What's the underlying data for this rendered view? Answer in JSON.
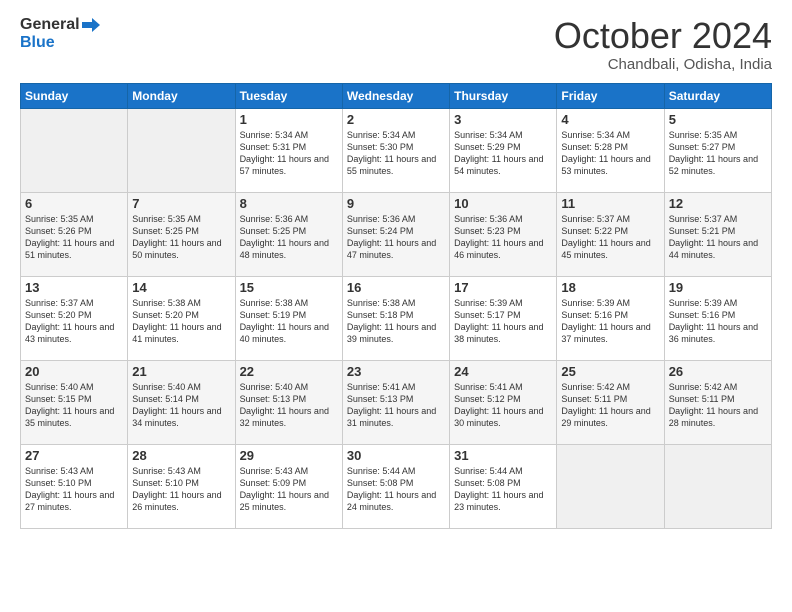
{
  "header": {
    "logo_line1": "General",
    "logo_line2": "Blue",
    "month": "October 2024",
    "location": "Chandbali, Odisha, India"
  },
  "weekdays": [
    "Sunday",
    "Monday",
    "Tuesday",
    "Wednesday",
    "Thursday",
    "Friday",
    "Saturday"
  ],
  "weeks": [
    [
      {
        "day": "",
        "info": ""
      },
      {
        "day": "",
        "info": ""
      },
      {
        "day": "1",
        "info": "Sunrise: 5:34 AM\nSunset: 5:31 PM\nDaylight: 11 hours and 57 minutes."
      },
      {
        "day": "2",
        "info": "Sunrise: 5:34 AM\nSunset: 5:30 PM\nDaylight: 11 hours and 55 minutes."
      },
      {
        "day": "3",
        "info": "Sunrise: 5:34 AM\nSunset: 5:29 PM\nDaylight: 11 hours and 54 minutes."
      },
      {
        "day": "4",
        "info": "Sunrise: 5:34 AM\nSunset: 5:28 PM\nDaylight: 11 hours and 53 minutes."
      },
      {
        "day": "5",
        "info": "Sunrise: 5:35 AM\nSunset: 5:27 PM\nDaylight: 11 hours and 52 minutes."
      }
    ],
    [
      {
        "day": "6",
        "info": "Sunrise: 5:35 AM\nSunset: 5:26 PM\nDaylight: 11 hours and 51 minutes."
      },
      {
        "day": "7",
        "info": "Sunrise: 5:35 AM\nSunset: 5:25 PM\nDaylight: 11 hours and 50 minutes."
      },
      {
        "day": "8",
        "info": "Sunrise: 5:36 AM\nSunset: 5:25 PM\nDaylight: 11 hours and 48 minutes."
      },
      {
        "day": "9",
        "info": "Sunrise: 5:36 AM\nSunset: 5:24 PM\nDaylight: 11 hours and 47 minutes."
      },
      {
        "day": "10",
        "info": "Sunrise: 5:36 AM\nSunset: 5:23 PM\nDaylight: 11 hours and 46 minutes."
      },
      {
        "day": "11",
        "info": "Sunrise: 5:37 AM\nSunset: 5:22 PM\nDaylight: 11 hours and 45 minutes."
      },
      {
        "day": "12",
        "info": "Sunrise: 5:37 AM\nSunset: 5:21 PM\nDaylight: 11 hours and 44 minutes."
      }
    ],
    [
      {
        "day": "13",
        "info": "Sunrise: 5:37 AM\nSunset: 5:20 PM\nDaylight: 11 hours and 43 minutes."
      },
      {
        "day": "14",
        "info": "Sunrise: 5:38 AM\nSunset: 5:20 PM\nDaylight: 11 hours and 41 minutes."
      },
      {
        "day": "15",
        "info": "Sunrise: 5:38 AM\nSunset: 5:19 PM\nDaylight: 11 hours and 40 minutes."
      },
      {
        "day": "16",
        "info": "Sunrise: 5:38 AM\nSunset: 5:18 PM\nDaylight: 11 hours and 39 minutes."
      },
      {
        "day": "17",
        "info": "Sunrise: 5:39 AM\nSunset: 5:17 PM\nDaylight: 11 hours and 38 minutes."
      },
      {
        "day": "18",
        "info": "Sunrise: 5:39 AM\nSunset: 5:16 PM\nDaylight: 11 hours and 37 minutes."
      },
      {
        "day": "19",
        "info": "Sunrise: 5:39 AM\nSunset: 5:16 PM\nDaylight: 11 hours and 36 minutes."
      }
    ],
    [
      {
        "day": "20",
        "info": "Sunrise: 5:40 AM\nSunset: 5:15 PM\nDaylight: 11 hours and 35 minutes."
      },
      {
        "day": "21",
        "info": "Sunrise: 5:40 AM\nSunset: 5:14 PM\nDaylight: 11 hours and 34 minutes."
      },
      {
        "day": "22",
        "info": "Sunrise: 5:40 AM\nSunset: 5:13 PM\nDaylight: 11 hours and 32 minutes."
      },
      {
        "day": "23",
        "info": "Sunrise: 5:41 AM\nSunset: 5:13 PM\nDaylight: 11 hours and 31 minutes."
      },
      {
        "day": "24",
        "info": "Sunrise: 5:41 AM\nSunset: 5:12 PM\nDaylight: 11 hours and 30 minutes."
      },
      {
        "day": "25",
        "info": "Sunrise: 5:42 AM\nSunset: 5:11 PM\nDaylight: 11 hours and 29 minutes."
      },
      {
        "day": "26",
        "info": "Sunrise: 5:42 AM\nSunset: 5:11 PM\nDaylight: 11 hours and 28 minutes."
      }
    ],
    [
      {
        "day": "27",
        "info": "Sunrise: 5:43 AM\nSunset: 5:10 PM\nDaylight: 11 hours and 27 minutes."
      },
      {
        "day": "28",
        "info": "Sunrise: 5:43 AM\nSunset: 5:10 PM\nDaylight: 11 hours and 26 minutes."
      },
      {
        "day": "29",
        "info": "Sunrise: 5:43 AM\nSunset: 5:09 PM\nDaylight: 11 hours and 25 minutes."
      },
      {
        "day": "30",
        "info": "Sunrise: 5:44 AM\nSunset: 5:08 PM\nDaylight: 11 hours and 24 minutes."
      },
      {
        "day": "31",
        "info": "Sunrise: 5:44 AM\nSunset: 5:08 PM\nDaylight: 11 hours and 23 minutes."
      },
      {
        "day": "",
        "info": ""
      },
      {
        "day": "",
        "info": ""
      }
    ]
  ]
}
